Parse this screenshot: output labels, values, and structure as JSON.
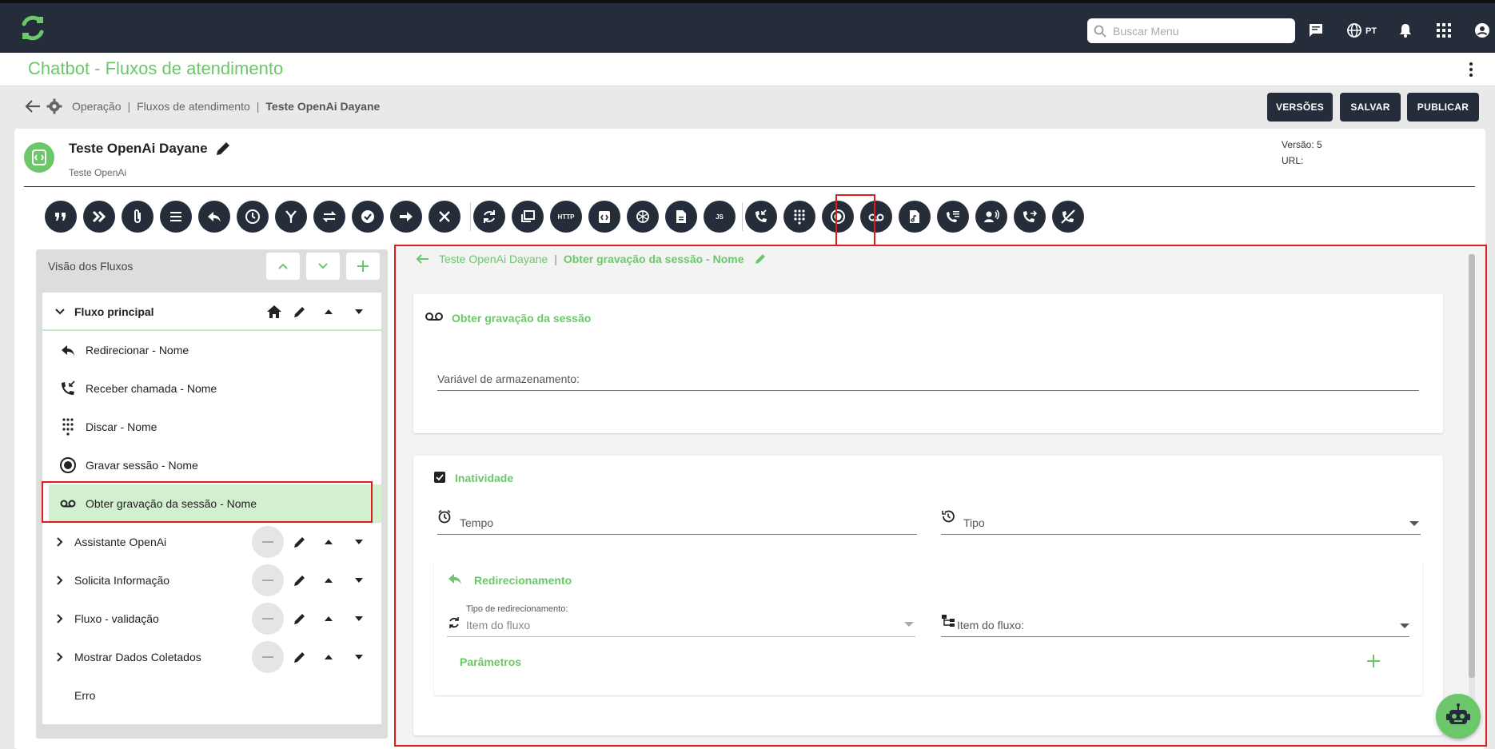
{
  "topbar": {
    "search_placeholder": "Buscar Menu",
    "language": "PT"
  },
  "page": {
    "title": "Chatbot - Fluxos de atendimento"
  },
  "breadcrumb": {
    "items": [
      "Operação",
      "Fluxos de atendimento"
    ],
    "current": "Teste OpenAi Dayane"
  },
  "actions": {
    "versions": "VERSÕES",
    "save": "SALVAR",
    "publish": "PUBLICAR"
  },
  "flow": {
    "name": "Teste OpenAi Dayane",
    "subtitle": "Teste OpenAi",
    "version": "Versão: 5",
    "url_label": "URL:"
  },
  "toolbar_icons": [
    "quote-icon",
    "double-chevron-icon",
    "paperclip-icon",
    "menu-list-icon",
    "reply-icon",
    "clock-icon",
    "branch-icon",
    "swap-icon",
    "check-icon",
    "arrow-right-icon",
    "close-icon",
    "sync-icon",
    "gallery-icon",
    "http-icon",
    "code-icon",
    "openai-icon",
    "document-icon",
    "js-icon",
    "incoming-call-icon",
    "dialpad-icon",
    "record-icon",
    "voicemail-icon",
    "audio-file-icon",
    "call-list-icon",
    "user-voice-icon",
    "call-transfer-icon",
    "hangup-icon"
  ],
  "toolbar_labels": {
    "http": "HTTP",
    "js": "JS"
  },
  "left_panel": {
    "title": "Visão dos Fluxos",
    "main_flow": "Fluxo principal",
    "main_items": [
      "Redirecionar - Nome",
      "Receber chamada - Nome",
      "Discar - Nome",
      "Gravar sessão - Nome",
      "Obter gravação da sessão - Nome"
    ],
    "other_flows": [
      "Assistante OpenAi",
      "Solicita Informação",
      "Fluxo - validação",
      "Mostrar Dados Coletados"
    ],
    "error_flow": "Erro"
  },
  "right_panel": {
    "breadcrumb_flow": "Teste OpenAi Dayane",
    "breadcrumb_current": "Obter gravação da sessão - Nome",
    "section1_title": "Obter gravação da sessão",
    "storage_label": "Variável de armazenamento:",
    "inactivity_title": "Inatividade",
    "time_label": "Tempo",
    "type_label": "Tipo",
    "redirect_title": "Redirecionamento",
    "redirect_type_label": "Tipo de redirecionamento:",
    "redirect_type_value": "Item do fluxo",
    "flow_item_label": "Item do fluxo:",
    "params_title": "Parâmetros"
  },
  "colors": {
    "accent": "#6cc76a",
    "dark": "#252d3a",
    "highlight": "#e01b1b"
  }
}
